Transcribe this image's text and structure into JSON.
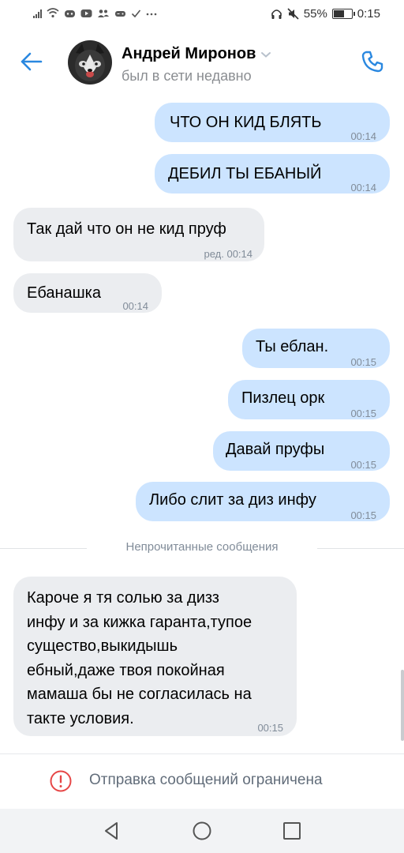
{
  "status_bar": {
    "battery_text": "55%",
    "time": "0:15",
    "battery_level": 0.55
  },
  "header": {
    "contact_name": "Андрей Миронов",
    "contact_status": "был в сети недавно",
    "icons": [
      "back-arrow-icon",
      "chevron-down-icon",
      "phone-icon"
    ]
  },
  "messages": [
    {
      "dir": "out",
      "text": "ЧТО ОН КИД БЛЯТЬ",
      "time": "00:14"
    },
    {
      "dir": "out",
      "text": "ДЕБИЛ ТЫ ЕБАНЫЙ",
      "time": "00:14"
    },
    {
      "dir": "in",
      "text": "Так дай что он не кид пруф",
      "time": "ред. 00:14"
    },
    {
      "dir": "in",
      "text": "Ебанашка",
      "time": "00:14"
    },
    {
      "dir": "out",
      "text": "Ты еблан.",
      "time": "00:15"
    },
    {
      "dir": "out",
      "text": "Пизлец орк",
      "time": "00:15"
    },
    {
      "dir": "out",
      "text": "Давай пруфы",
      "time": "00:15"
    },
    {
      "dir": "out",
      "text": "Либо слит за диз инфу",
      "time": "00:15"
    },
    {
      "dir": "in",
      "text": [
        "Кароче я тя солью за дизз",
        "инфу и за кижка гаранта,тупое",
        "существо,выкидышь",
        "ебный,даже твоя покойная",
        "мамаша бы не согласилась на",
        "такте условия."
      ],
      "time": "00:15"
    }
  ],
  "unread_divider": "Непрочитанные сообщения",
  "notice": {
    "text": "Отправка сообщений ограничена",
    "icon": "warning-circle-icon"
  },
  "navbar": {
    "icons": [
      "back-triangle-icon",
      "home-circle-icon",
      "recents-square-icon"
    ]
  },
  "colors": {
    "accent": "#2a88e0",
    "out_bubble": "#cce4ff",
    "in_bubble": "#ebedf0",
    "warning": "#e64646"
  }
}
